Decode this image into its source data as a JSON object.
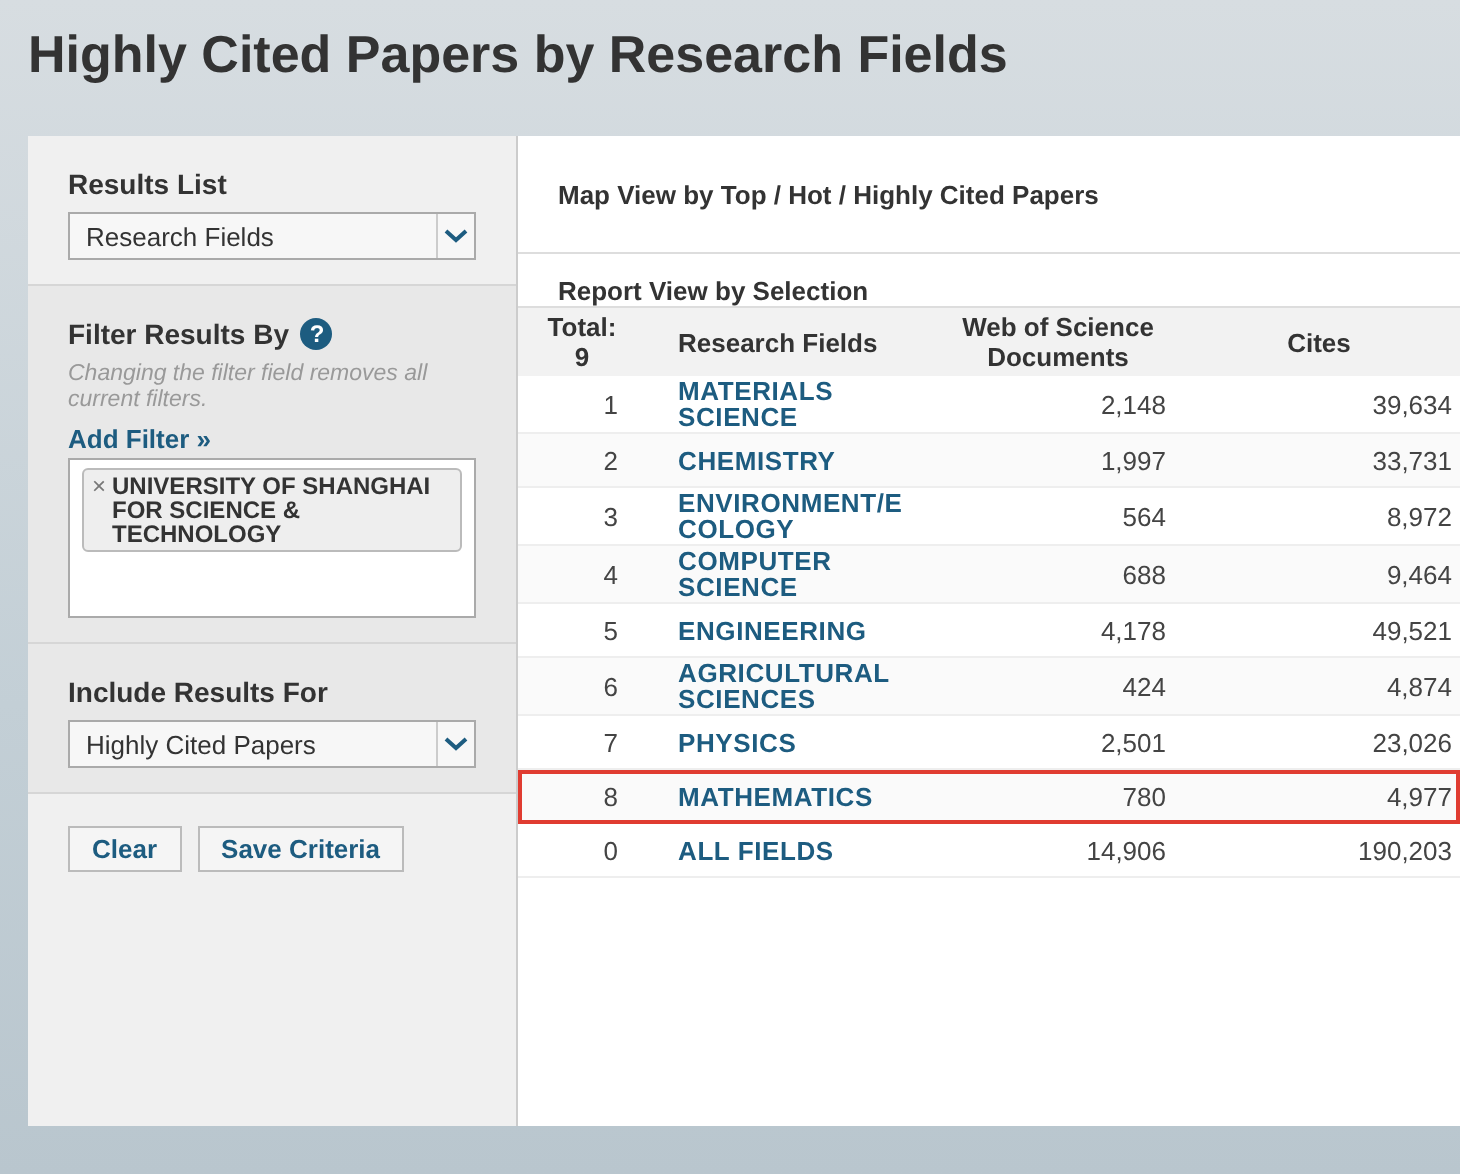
{
  "page_title": "Highly Cited Papers by Research Fields",
  "sidebar": {
    "results_list": {
      "label": "Results List",
      "value": "Research Fields"
    },
    "filter": {
      "label": "Filter Results By",
      "help": "?",
      "note": "Changing the filter field removes all current filters.",
      "add_link": "Add Filter »",
      "tags": [
        {
          "remove": "×",
          "text": "UNIVERSITY OF SHANGHAI FOR SCIENCE & TECHNOLOGY"
        }
      ]
    },
    "include": {
      "label": "Include Results For",
      "value": "Highly Cited Papers"
    },
    "buttons": [
      "Clear",
      "Save Criteria"
    ]
  },
  "main": {
    "map_view": "Map View by Top / Hot / Highly Cited Papers",
    "report_view": "Report View by Selection",
    "table": {
      "columns": [
        "Total:\n9",
        "Research Fields",
        "Web of Science\nDocuments",
        "Cites"
      ],
      "rows": [
        {
          "rank": "1",
          "field": "MATERIALS\nSCIENCE",
          "documents": "2,148",
          "cites": "39,634",
          "highlighted": false
        },
        {
          "rank": "2",
          "field": "CHEMISTRY",
          "documents": "1,997",
          "cites": "33,731",
          "highlighted": false
        },
        {
          "rank": "3",
          "field": "ENVIRONMENT/E\nCOLOGY",
          "documents": "564",
          "cites": "8,972",
          "highlighted": false
        },
        {
          "rank": "4",
          "field": "COMPUTER\nSCIENCE",
          "documents": "688",
          "cites": "9,464",
          "highlighted": false
        },
        {
          "rank": "5",
          "field": "ENGINEERING",
          "documents": "4,178",
          "cites": "49,521",
          "highlighted": false
        },
        {
          "rank": "6",
          "field": "AGRICULTURAL\nSCIENCES",
          "documents": "424",
          "cites": "4,874",
          "highlighted": false
        },
        {
          "rank": "7",
          "field": "PHYSICS",
          "documents": "2,501",
          "cites": "23,026",
          "highlighted": false
        },
        {
          "rank": "8",
          "field": "MATHEMATICS",
          "documents": "780",
          "cites": "4,977",
          "highlighted": true
        },
        {
          "rank": "0",
          "field": "ALL FIELDS",
          "documents": "14,906",
          "cites": "190,203",
          "highlighted": false
        }
      ]
    }
  }
}
